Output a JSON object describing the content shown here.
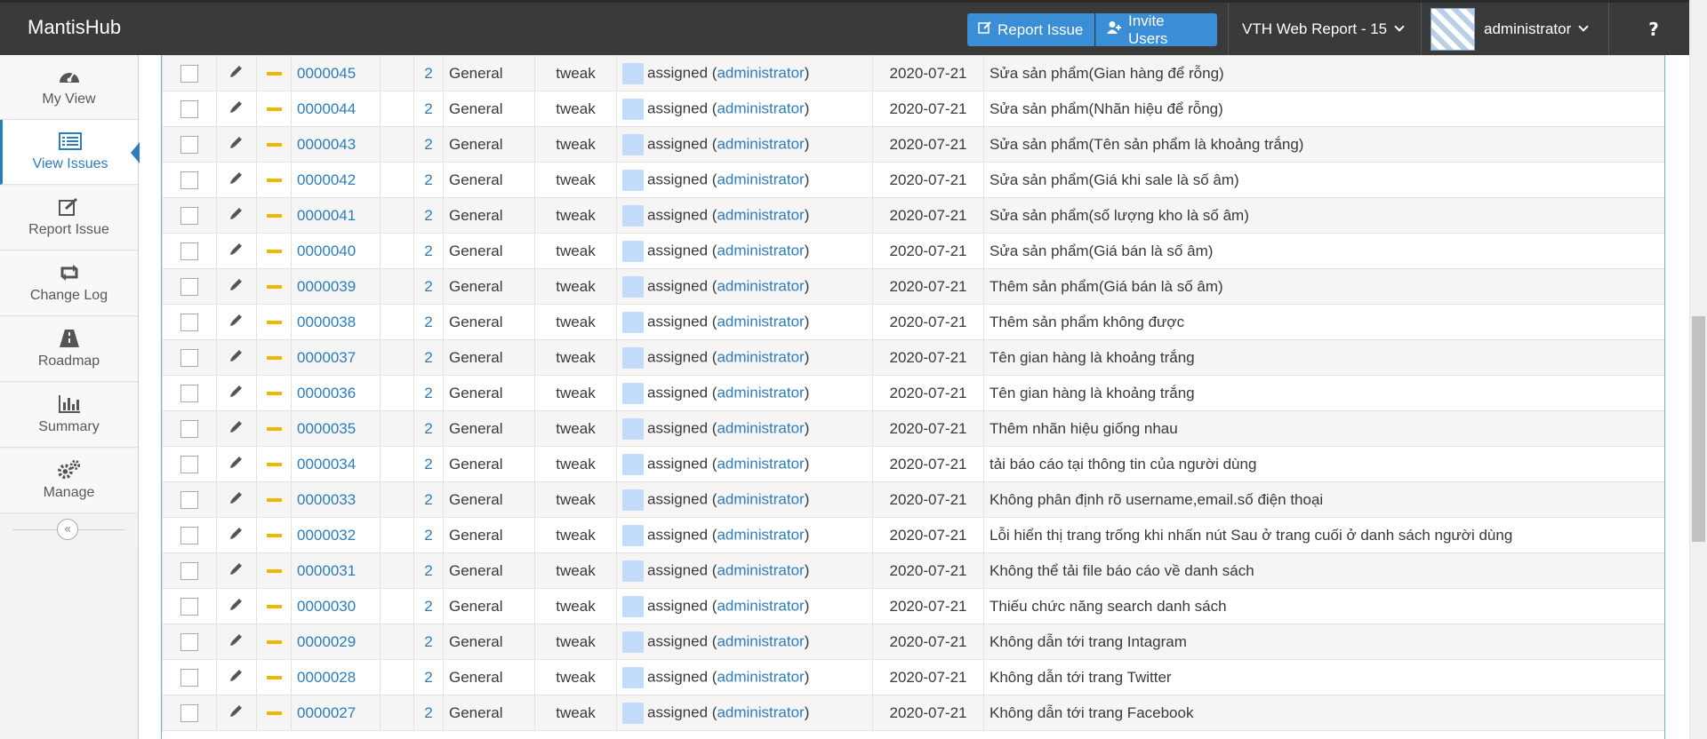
{
  "app": {
    "brand": "MantisHub"
  },
  "navbar": {
    "report_issue": "Report Issue",
    "invite_users": "Invite Users",
    "project": "VTH Web Report - 15",
    "user": "administrator",
    "help": "?"
  },
  "sidebar": {
    "items": [
      {
        "label": "My View",
        "icon": "dashboard-icon"
      },
      {
        "label": "View Issues",
        "icon": "list-icon"
      },
      {
        "label": "Report Issue",
        "icon": "edit-icon"
      },
      {
        "label": "Change Log",
        "icon": "retweet-icon"
      },
      {
        "label": "Roadmap",
        "icon": "road-icon"
      },
      {
        "label": "Summary",
        "icon": "bar-chart-icon"
      },
      {
        "label": "Manage",
        "icon": "gears-icon"
      }
    ],
    "collapse_glyph": "«"
  },
  "colors": {
    "navbar": "#3a3a3a",
    "accent": "#2b7dbc",
    "button": "#3a8ed6",
    "priority": "#f4b400",
    "status": "#c2dcfa"
  },
  "issues": [
    {
      "id": "0000045",
      "count": "2",
      "category": "General",
      "severity": "tweak",
      "status": "assigned",
      "handler": "administrator",
      "date": "2020-07-21",
      "summary": "Sửa sản phẩm(Gian hàng để rỗng)"
    },
    {
      "id": "0000044",
      "count": "2",
      "category": "General",
      "severity": "tweak",
      "status": "assigned",
      "handler": "administrator",
      "date": "2020-07-21",
      "summary": "Sửa sản phẩm(Nhãn hiệu để rỗng)"
    },
    {
      "id": "0000043",
      "count": "2",
      "category": "General",
      "severity": "tweak",
      "status": "assigned",
      "handler": "administrator",
      "date": "2020-07-21",
      "summary": "Sửa sản phẩm(Tên sản phẩm là khoảng trắng)"
    },
    {
      "id": "0000042",
      "count": "2",
      "category": "General",
      "severity": "tweak",
      "status": "assigned",
      "handler": "administrator",
      "date": "2020-07-21",
      "summary": "Sửa sản phẩm(Giá khi sale là số âm)"
    },
    {
      "id": "0000041",
      "count": "2",
      "category": "General",
      "severity": "tweak",
      "status": "assigned",
      "handler": "administrator",
      "date": "2020-07-21",
      "summary": "Sửa sản phẩm(số lượng kho là số âm)"
    },
    {
      "id": "0000040",
      "count": "2",
      "category": "General",
      "severity": "tweak",
      "status": "assigned",
      "handler": "administrator",
      "date": "2020-07-21",
      "summary": "Sửa sản phẩm(Giá bán là số âm)"
    },
    {
      "id": "0000039",
      "count": "2",
      "category": "General",
      "severity": "tweak",
      "status": "assigned",
      "handler": "administrator",
      "date": "2020-07-21",
      "summary": "Thêm sản phẩm(Giá bán là số âm)"
    },
    {
      "id": "0000038",
      "count": "2",
      "category": "General",
      "severity": "tweak",
      "status": "assigned",
      "handler": "administrator",
      "date": "2020-07-21",
      "summary": "Thêm sản phẩm không được"
    },
    {
      "id": "0000037",
      "count": "2",
      "category": "General",
      "severity": "tweak",
      "status": "assigned",
      "handler": "administrator",
      "date": "2020-07-21",
      "summary": "Tên gian hàng là khoảng trắng"
    },
    {
      "id": "0000036",
      "count": "2",
      "category": "General",
      "severity": "tweak",
      "status": "assigned",
      "handler": "administrator",
      "date": "2020-07-21",
      "summary": "Tên gian hàng là khoảng trắng"
    },
    {
      "id": "0000035",
      "count": "2",
      "category": "General",
      "severity": "tweak",
      "status": "assigned",
      "handler": "administrator",
      "date": "2020-07-21",
      "summary": "Thêm nhãn hiệu giống nhau"
    },
    {
      "id": "0000034",
      "count": "2",
      "category": "General",
      "severity": "tweak",
      "status": "assigned",
      "handler": "administrator",
      "date": "2020-07-21",
      "summary": "tải báo cáo tại thông tin của người dùng"
    },
    {
      "id": "0000033",
      "count": "2",
      "category": "General",
      "severity": "tweak",
      "status": "assigned",
      "handler": "administrator",
      "date": "2020-07-21",
      "summary": "Không phân định rõ username,email.số điện thoại"
    },
    {
      "id": "0000032",
      "count": "2",
      "category": "General",
      "severity": "tweak",
      "status": "assigned",
      "handler": "administrator",
      "date": "2020-07-21",
      "summary": "Lỗi hiển thị trang trống khi nhấn nút Sau ở trang cuối ở danh sách người dùng"
    },
    {
      "id": "0000031",
      "count": "2",
      "category": "General",
      "severity": "tweak",
      "status": "assigned",
      "handler": "administrator",
      "date": "2020-07-21",
      "summary": "Không thể tải file báo cáo về danh sách"
    },
    {
      "id": "0000030",
      "count": "2",
      "category": "General",
      "severity": "tweak",
      "status": "assigned",
      "handler": "administrator",
      "date": "2020-07-21",
      "summary": "Thiếu chức năng search danh sách"
    },
    {
      "id": "0000029",
      "count": "2",
      "category": "General",
      "severity": "tweak",
      "status": "assigned",
      "handler": "administrator",
      "date": "2020-07-21",
      "summary": "Không dẫn tới trang Intagram"
    },
    {
      "id": "0000028",
      "count": "2",
      "category": "General",
      "severity": "tweak",
      "status": "assigned",
      "handler": "administrator",
      "date": "2020-07-21",
      "summary": "Không dẫn tới trang Twitter"
    },
    {
      "id": "0000027",
      "count": "2",
      "category": "General",
      "severity": "tweak",
      "status": "assigned",
      "handler": "administrator",
      "date": "2020-07-21",
      "summary": "Không dẫn tới trang Facebook"
    }
  ]
}
